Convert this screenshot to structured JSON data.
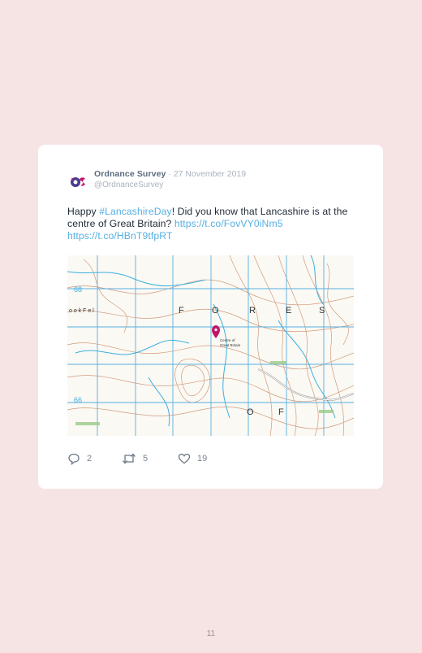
{
  "tweet": {
    "author_name": "Ordnance Survey",
    "separator": "·",
    "date": "27 November 2019",
    "handle": "@OrdnanceSurvey",
    "text_intro": "Happy ",
    "hashtag": "#LancashireDay",
    "text_body": "! Did you know that Lancashire is at the centre of Great Britain? ",
    "link1": "https://t.co/FovVY0iNm5",
    "link2": "https://t.co/HBnT9tfpRT"
  },
  "map": {
    "grid_left": "68",
    "grid_left_bottom": "66",
    "forest_letters": [
      "F",
      "O",
      "R",
      "E",
      "S"
    ],
    "forest_letters_bottom": [
      "O",
      "F"
    ],
    "place_label_left": "o o k   F e l",
    "pin_label_line1": "Centre of",
    "pin_label_line2": "Great Britain",
    "pin_color": "#c0166a",
    "contour_color": "#c98a6a",
    "water_color": "#3bb0e0"
  },
  "actions": {
    "replies": "2",
    "retweets": "5",
    "likes": "19"
  },
  "page_number": "11"
}
